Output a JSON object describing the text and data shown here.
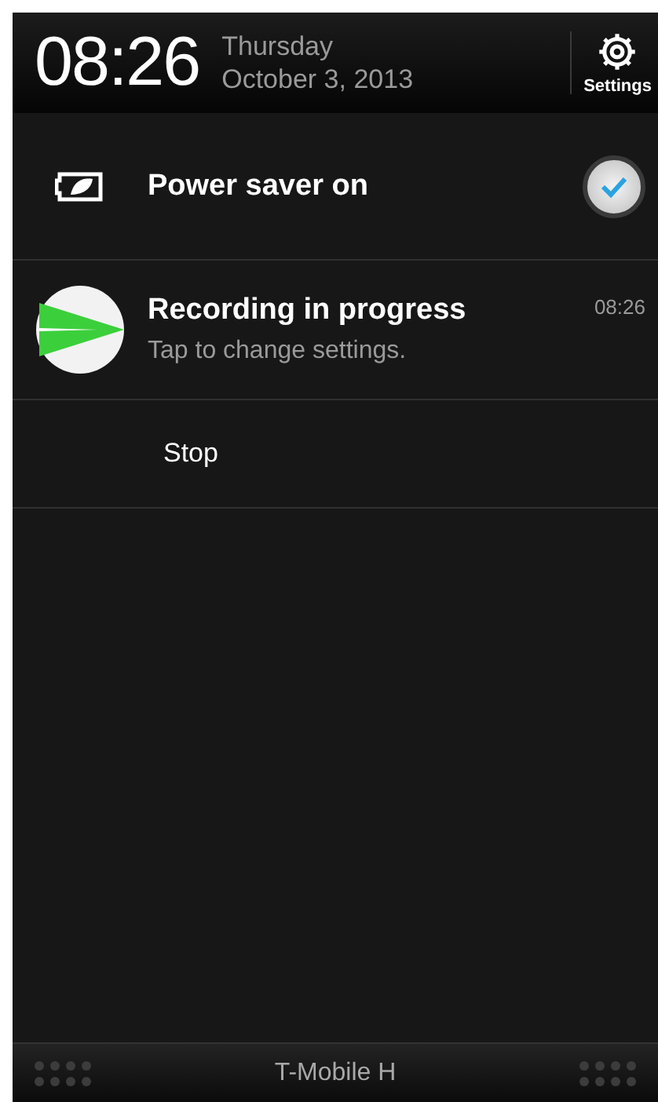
{
  "header": {
    "time": "08:26",
    "weekday": "Thursday",
    "date": "October 3, 2013",
    "settings_label": "Settings"
  },
  "power_saver": {
    "label": "Power saver on",
    "checked": true
  },
  "notification": {
    "title": "Recording in progress",
    "subtitle": "Tap to change settings.",
    "time": "08:26",
    "action": "Stop"
  },
  "footer": {
    "carrier": "T-Mobile H"
  }
}
